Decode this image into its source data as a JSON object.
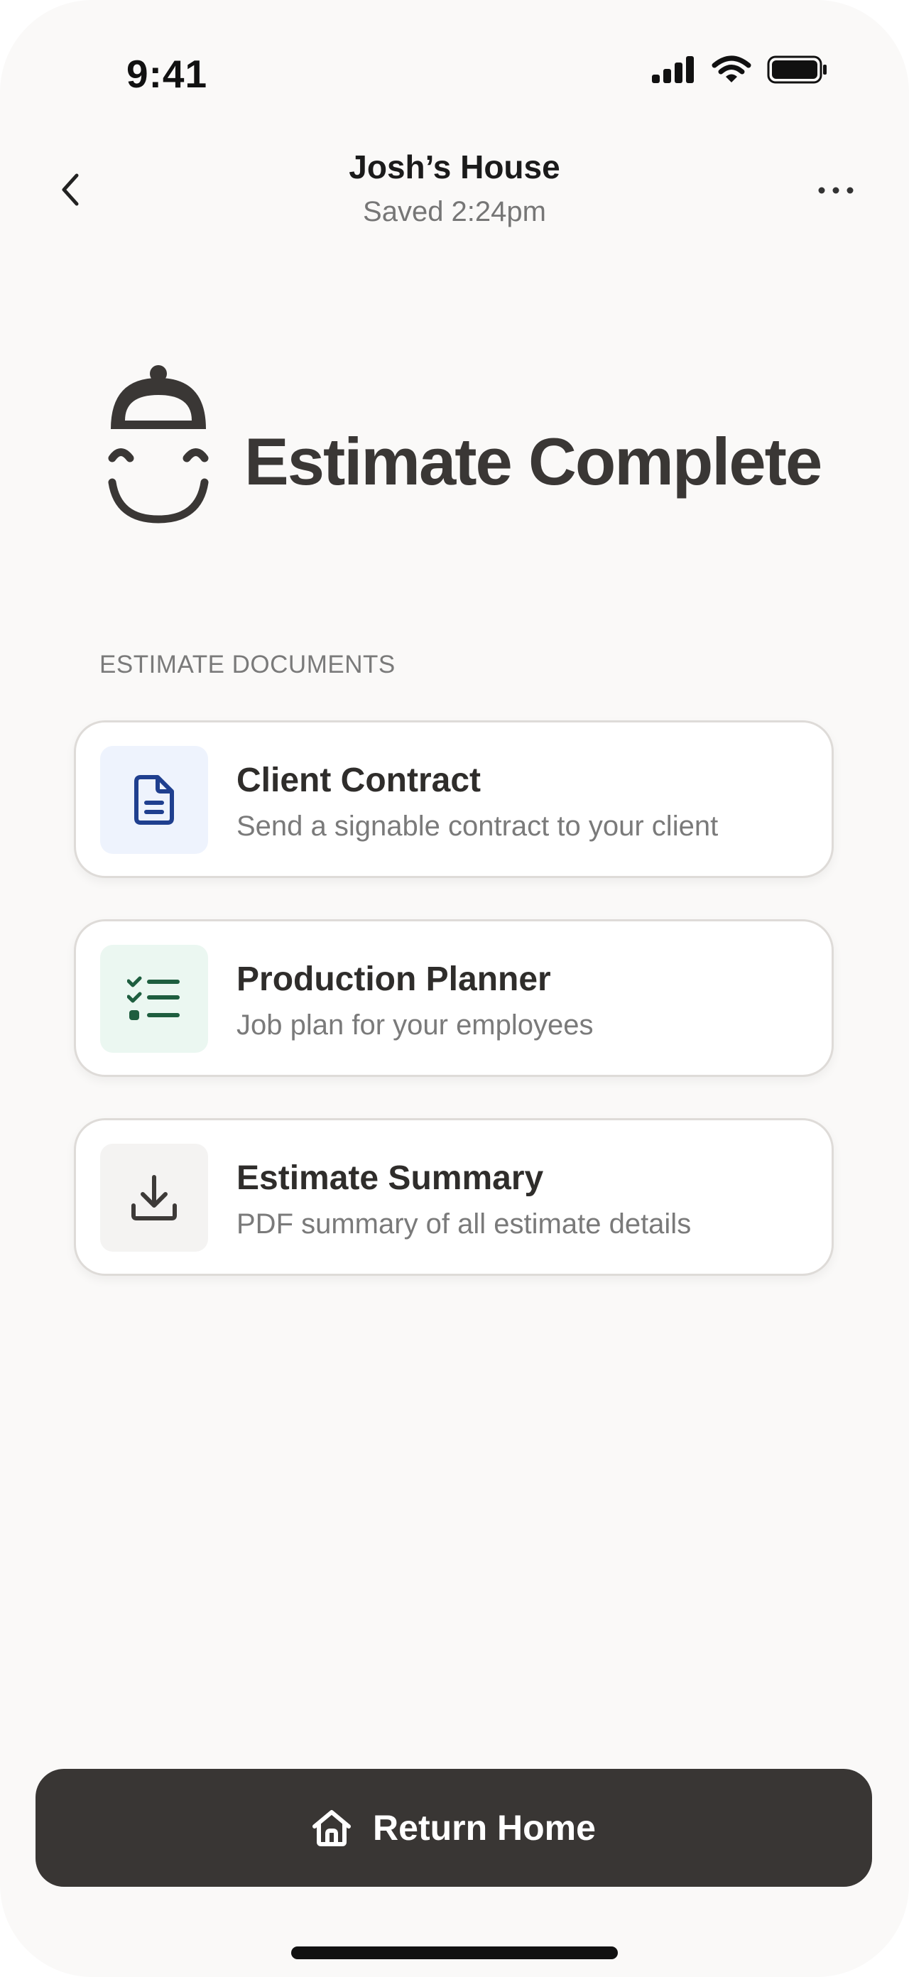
{
  "status_bar": {
    "time": "9:41",
    "icons": [
      "cellular-signal-icon",
      "wifi-icon",
      "battery-icon"
    ]
  },
  "header": {
    "title": "Josh’s House",
    "subtitle": "Saved 2:24pm",
    "back_icon": "chevron-left-icon",
    "more_icon": "more-horizontal-icon"
  },
  "hero": {
    "logo": "smiling-hardhat-face-logo",
    "title": "Estimate Complete"
  },
  "documents": {
    "section_label": "ESTIMATE DOCUMENTS",
    "items": [
      {
        "title": "Client Contract",
        "description": "Send a signable contract to your client",
        "icon": "document-icon",
        "icon_color": "#1f3f8f",
        "icon_bg": "#eef3fd"
      },
      {
        "title": "Production Planner",
        "description": "Job plan for your employees",
        "icon": "checklist-icon",
        "icon_color": "#1e5e3f",
        "icon_bg": "#ebf7f1"
      },
      {
        "title": "Estimate Summary",
        "description": "PDF summary of all estimate details",
        "icon": "download-icon",
        "icon_color": "#3d3a38",
        "icon_bg": "#f4f3f2"
      }
    ]
  },
  "footer": {
    "button_label": "Return Home",
    "button_icon": "home-icon",
    "button_color": "#393634"
  }
}
